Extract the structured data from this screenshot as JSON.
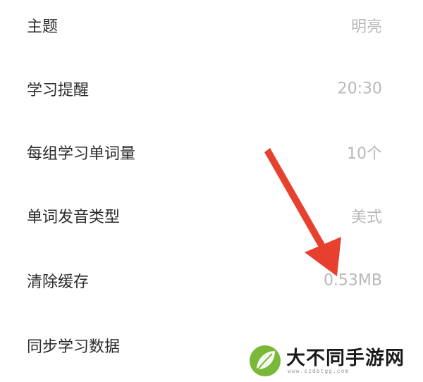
{
  "settings": {
    "items": [
      {
        "label": "主题",
        "value": "明亮"
      },
      {
        "label": "学习提醒",
        "value": "20:30"
      },
      {
        "label": "每组学习单词量",
        "value": "10个"
      },
      {
        "label": "单词发音类型",
        "value": "美式"
      },
      {
        "label": "清除缓存",
        "value": "0.53MB"
      },
      {
        "label": "同步学习数据",
        "value": ""
      }
    ]
  },
  "annotation": {
    "arrow_color": "#e8402e",
    "arrow_icon": "red-arrow-icon"
  },
  "watermark": {
    "title": "大不同手游网",
    "url": "www.szdbtgg.com",
    "logo_icon": "leaf-logo-icon",
    "logo_color": "#7ab83a"
  }
}
